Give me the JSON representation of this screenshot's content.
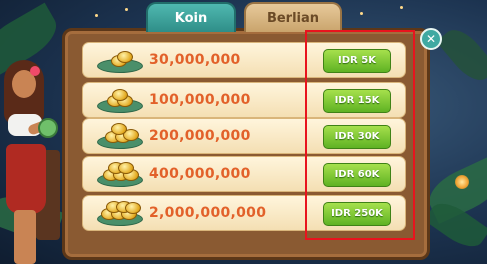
{
  "tabs": [
    {
      "label": "Koin",
      "active": true
    },
    {
      "label": "Berlian",
      "active": false
    }
  ],
  "close_icon": "close-icon",
  "packages": [
    {
      "amount": "30,000,000",
      "price": "IDR 5K"
    },
    {
      "amount": "100,000,000",
      "price": "IDR 15K"
    },
    {
      "amount": "200,000,000",
      "price": "IDR 30K"
    },
    {
      "amount": "400,000,000",
      "price": "IDR 60K"
    },
    {
      "amount": "2,000,000,000",
      "price": "IDR 250K"
    }
  ],
  "colors": {
    "active_tab": "#3fa9a2",
    "inactive_tab": "#d9b883",
    "amount_text": "#e2612a",
    "price_button": "#7cc43a",
    "highlight": "#e8141e"
  }
}
